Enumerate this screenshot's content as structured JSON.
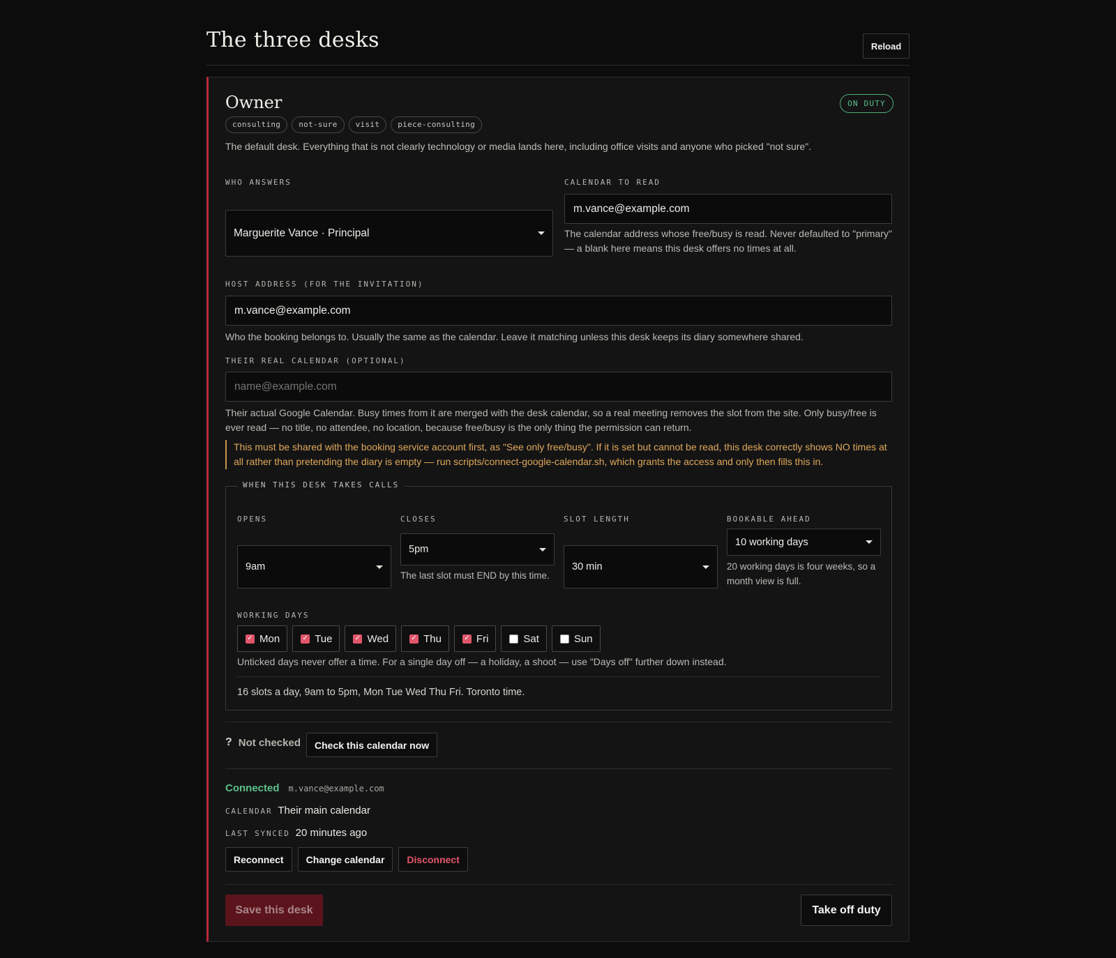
{
  "page": {
    "title": "The three desks",
    "reload_label": "Reload"
  },
  "desk": {
    "name": "Owner",
    "status": "ON DUTY",
    "tags": [
      "consulting",
      "not-sure",
      "visit",
      "piece-consulting"
    ],
    "description": "The default desk. Everything that is not clearly technology or media lands here, including office visits and anyone who picked \"not sure\".",
    "who_answers": {
      "label": "WHO ANSWERS",
      "value": "Marguerite Vance · Principal"
    },
    "calendar_to_read": {
      "label": "CALENDAR TO READ",
      "value": "m.vance@example.com",
      "help": "The calendar address whose free/busy is read. Never defaulted to \"primary\" — a blank here means this desk offers no times at all."
    },
    "host_address": {
      "label": "HOST ADDRESS (FOR THE INVITATION)",
      "value": "m.vance@example.com",
      "help": "Who the booking belongs to. Usually the same as the calendar. Leave it matching unless this desk keeps its diary somewhere shared."
    },
    "real_calendar": {
      "label": "THEIR REAL CALENDAR (OPTIONAL)",
      "value": "",
      "placeholder": "name@example.com",
      "help": "Their actual Google Calendar. Busy times from it are merged with the desk calendar, so a real meeting removes the slot from the site. Only busy/free is ever read — no title, no attendee, no location, because free/busy is the only thing the permission can return.",
      "warning": "This must be shared with the booking service account first, as \"See only free/busy\". If it is set but cannot be read, this desk correctly shows NO times at all rather than pretending the diary is empty — run scripts/connect-google-calendar.sh, which grants the access and only then fills this in."
    },
    "hours": {
      "legend": "WHEN THIS DESK TAKES CALLS",
      "opens": {
        "label": "OPENS",
        "value": "9am"
      },
      "closes": {
        "label": "CLOSES",
        "value": "5pm",
        "help": "The last slot must END by this time."
      },
      "slot_length": {
        "label": "SLOT LENGTH",
        "value": "30 min"
      },
      "bookable_ahead": {
        "label": "BOOKABLE AHEAD",
        "value": "10 working days",
        "help": "20 working days is four weeks, so a month view is full."
      },
      "working_days_label": "WORKING DAYS",
      "days": [
        {
          "label": "Mon",
          "checked": true
        },
        {
          "label": "Tue",
          "checked": true
        },
        {
          "label": "Wed",
          "checked": true
        },
        {
          "label": "Thu",
          "checked": true
        },
        {
          "label": "Fri",
          "checked": true
        },
        {
          "label": "Sat",
          "checked": false
        },
        {
          "label": "Sun",
          "checked": false
        }
      ],
      "days_help": "Unticked days never offer a time. For a single day off — a holiday, a shoot — use \"Days off\" further down instead.",
      "summary": "16 slots a day, 9am to 5pm, Mon Tue Wed Thu Fri. Toronto time."
    },
    "check": {
      "icon": "?",
      "status": "Not checked",
      "button": "Check this calendar now"
    },
    "connection": {
      "status": "Connected",
      "email": "m.vance@example.com",
      "calendar_label": "CALENDAR",
      "calendar_value": "Their main calendar",
      "synced_label": "LAST SYNCED",
      "synced_value": "20 minutes ago",
      "buttons": {
        "reconnect": "Reconnect",
        "change": "Change calendar",
        "disconnect": "Disconnect"
      }
    },
    "footer": {
      "save": "Save this desk",
      "off_duty": "Take off duty"
    }
  },
  "colors": {
    "accent": "#b8293a",
    "on_duty": "#5cc18a",
    "warning": "#e0a85a",
    "danger": "#e2566a",
    "background": "#0c0c0d"
  }
}
